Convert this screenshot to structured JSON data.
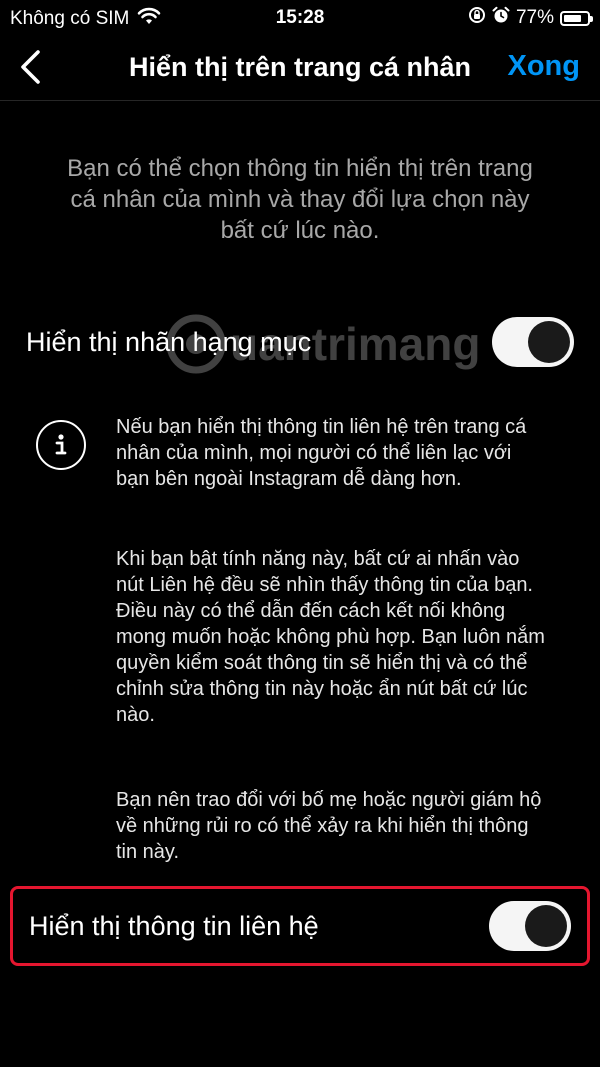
{
  "status_bar": {
    "carrier": "Không có SIM",
    "time": "15:28",
    "battery": "77%",
    "battery_level": 0.77
  },
  "nav": {
    "title": "Hiển thị trên trang cá nhân",
    "done_label": "Xong"
  },
  "intro": "Bạn có thể chọn thông tin hiển thị trên trang cá nhân của mình và thay đổi lựa chọn này bất cứ lúc nào.",
  "settings": [
    {
      "label": "Hiển thị nhãn hạng mục",
      "enabled": true
    },
    {
      "label": "Hiển thị thông tin liên hệ",
      "enabled": true
    }
  ],
  "info": {
    "paragraph1": "Nếu bạn hiển thị thông tin liên hệ trên trang cá nhân của mình, mọi người có thể liên lạc với bạn bên ngoài Instagram dễ dàng hơn.",
    "paragraph2": "Khi bạn bật tính năng này, bất cứ ai nhấn vào nút Liên hệ đều sẽ nhìn thấy thông tin của bạn. Điều này có thể dẫn đến cách kết nối không mong muốn hoặc không phù hợp. Bạn luôn nắm quyền kiểm soát thông tin sẽ hiển thị và có thể chỉnh sửa thông tin này hoặc ẩn nút bất cứ lúc nào.",
    "paragraph3": "Bạn nên trao đổi với bố mẹ hoặc người giám hộ về những rủi ro có thể xảy ra khi hiển thị thông tin này."
  },
  "watermark": "uantrimang",
  "colors": {
    "accent": "#0095f6",
    "highlight": "#e5162f",
    "background": "#000000"
  }
}
